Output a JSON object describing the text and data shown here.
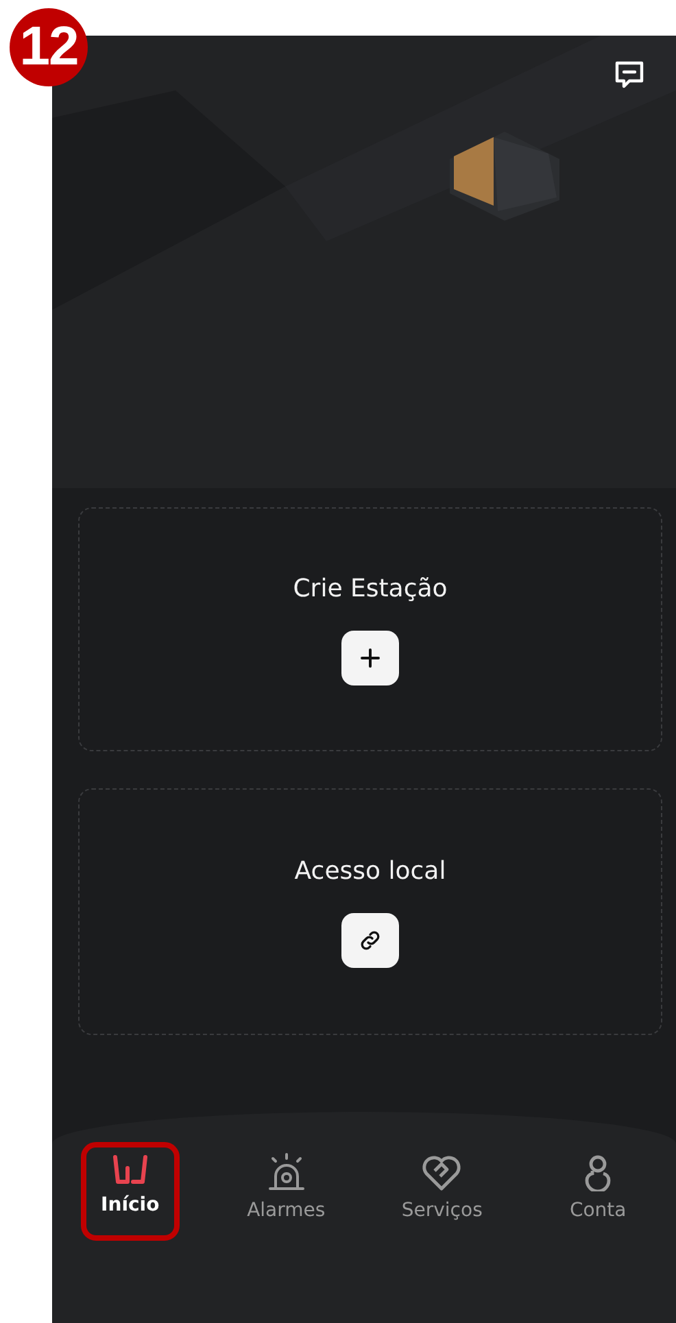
{
  "step_badge": "12",
  "cards": [
    {
      "title": "Crie Estação",
      "kind": "add"
    },
    {
      "title": "Acesso local",
      "kind": "link"
    }
  ],
  "nav": [
    {
      "label": "Início",
      "kind": "home",
      "selected": true,
      "highlighted": true
    },
    {
      "label": "Alarmes",
      "kind": "alarm",
      "selected": false,
      "highlighted": false
    },
    {
      "label": "Serviços",
      "kind": "services",
      "selected": false,
      "highlighted": false
    },
    {
      "label": "Conta",
      "kind": "account",
      "selected": false,
      "highlighted": false
    }
  ]
}
